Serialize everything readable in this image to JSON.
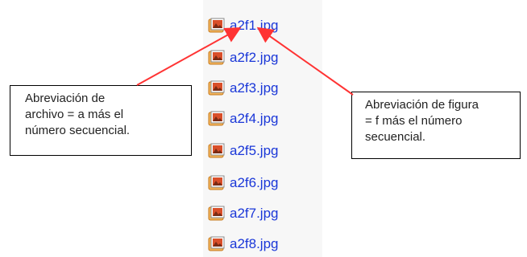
{
  "files": [
    {
      "name": "a2f1.jpg",
      "icon": "image-file-icon"
    },
    {
      "name": "a2f2.jpg",
      "icon": "image-file-icon"
    },
    {
      "name": "a2f3.jpg",
      "icon": "image-file-icon"
    },
    {
      "name": "a2f4.jpg",
      "icon": "image-file-icon"
    },
    {
      "name": "a2f5.jpg",
      "icon": "image-file-icon"
    },
    {
      "name": "a2f6.jpg",
      "icon": "image-file-icon"
    },
    {
      "name": "a2f7.jpg",
      "icon": "image-file-icon"
    },
    {
      "name": "a2f8.jpg",
      "icon": "image-file-icon"
    }
  ],
  "callouts": {
    "left": {
      "line1": "Abreviación de",
      "line2": "archivo = a más el",
      "line3": "número secuencial."
    },
    "right": {
      "line1": "Abreviación de figura",
      "line2": "= f más el número",
      "line3": "secuencial."
    }
  },
  "colors": {
    "file_link": "#1a37d8",
    "arrow": "#ff3333",
    "callout_border": "#000000"
  }
}
